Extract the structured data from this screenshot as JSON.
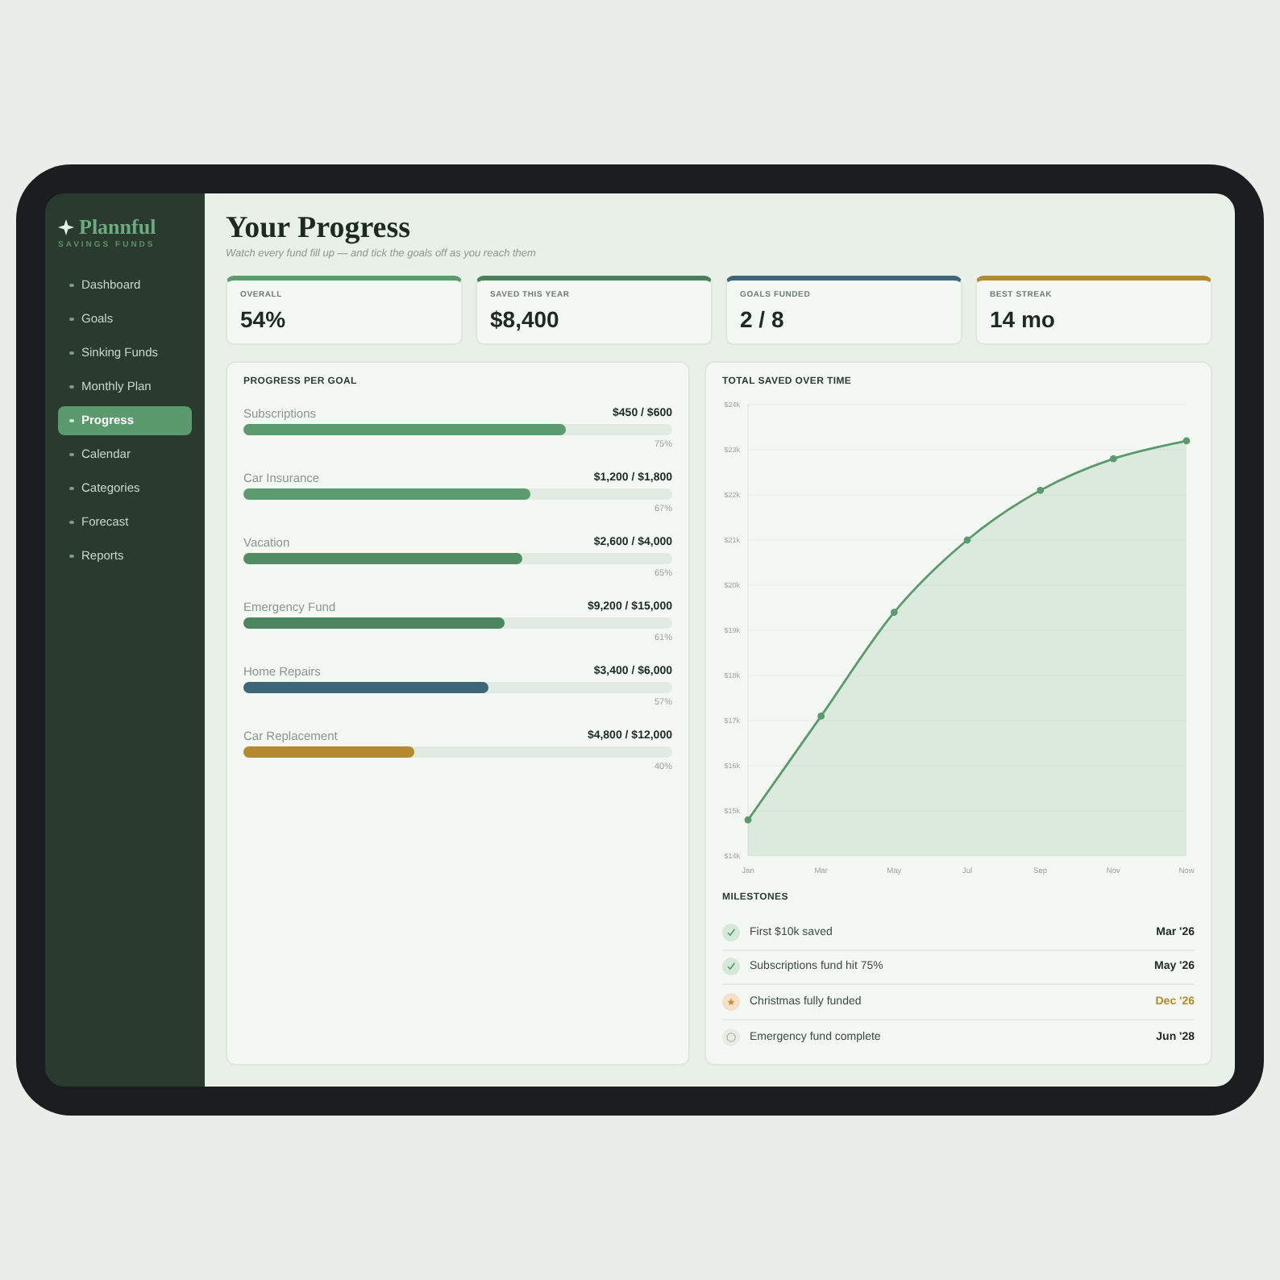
{
  "app": {
    "logo": "Plannful",
    "tagline": "SAVINGS FUNDS"
  },
  "sidebar": {
    "items": [
      {
        "label": "Dashboard",
        "selected": false
      },
      {
        "label": "Goals",
        "selected": false
      },
      {
        "label": "Sinking Funds",
        "selected": false
      },
      {
        "label": "Monthly Plan",
        "selected": false
      },
      {
        "label": "Progress",
        "selected": true
      },
      {
        "label": "Calendar",
        "selected": false
      },
      {
        "label": "Categories",
        "selected": false
      },
      {
        "label": "Forecast",
        "selected": false
      },
      {
        "label": "Reports",
        "selected": false
      }
    ]
  },
  "header": {
    "title": "Your Progress",
    "subtitle": "Watch every fund fill up — and tick the goals off as you reach them"
  },
  "stats": [
    {
      "label": "OVERALL",
      "value": "54%",
      "color": "#5b9c6c"
    },
    {
      "label": "SAVED THIS YEAR",
      "value": "$8,400",
      "color": "#4a805b"
    },
    {
      "label": "GOALS FUNDED",
      "value": "2 / 8",
      "color": "#3e6579"
    },
    {
      "label": "BEST STREAK",
      "value": "14 mo",
      "color": "#b38a32"
    }
  ],
  "goals_panel": {
    "title": "PROGRESS PER GOAL",
    "goals": [
      {
        "name": "Subscriptions",
        "amount": "$450 / $600",
        "level": 0.75,
        "percent": "75%",
        "color": "#5b9b6e"
      },
      {
        "name": "Car Insurance",
        "amount": "$1,200 / $1,800",
        "level": 0.67,
        "percent": "67%",
        "color": "#5b9b6e"
      },
      {
        "name": "Vacation",
        "amount": "$2,600 / $4,000",
        "level": 0.65,
        "percent": "65%",
        "color": "#528e64"
      },
      {
        "name": "Emergency Fund",
        "amount": "$9,200 / $15,000",
        "level": 0.61,
        "percent": "61%",
        "color": "#4c8660"
      },
      {
        "name": "Home Repairs",
        "amount": "$3,400 / $6,000",
        "level": 0.57,
        "percent": "57%",
        "color": "#3e6679"
      },
      {
        "name": "Car Replacement",
        "amount": "$4,800 / $12,000",
        "level": 0.4,
        "percent": "40%",
        "color": "#b38a32"
      }
    ]
  },
  "chart_panel": {
    "title": "TOTAL SAVED OVER TIME",
    "chart_data": {
      "type": "area",
      "grid": true,
      "categories": [
        "Jan",
        "Mar",
        "May",
        "Jul",
        "Sep",
        "Nov",
        "Now"
      ],
      "series": [
        {
          "color": "#5a9a6c",
          "values": [
            14800,
            17100,
            19400,
            21000,
            22100,
            22800,
            23200
          ]
        }
      ],
      "ylim": [
        14000,
        24000
      ],
      "yticks": [
        {
          "value": 14000,
          "label": "$14k"
        },
        {
          "value": 15000,
          "label": "$15k"
        },
        {
          "value": 16000,
          "label": "$16k"
        },
        {
          "value": 17000,
          "label": "$17k"
        },
        {
          "value": 18000,
          "label": "$18k"
        },
        {
          "value": 19000,
          "label": "$19k"
        },
        {
          "value": 20000,
          "label": "$20k"
        },
        {
          "value": 21000,
          "label": "$21k"
        },
        {
          "value": 22000,
          "label": "$22k"
        },
        {
          "value": 23000,
          "label": "$23k"
        },
        {
          "value": 24000,
          "label": "$24k"
        }
      ]
    }
  },
  "milestones": {
    "title": "MILESTONES",
    "items": [
      {
        "label": "First $10k saved",
        "date": "Mar '26",
        "kind": "done"
      },
      {
        "label": "Subscriptions fund hit 75%",
        "date": "May '26",
        "kind": "done"
      },
      {
        "label": "Christmas fully funded",
        "date": "Dec '26",
        "kind": "upcoming"
      },
      {
        "label": "Emergency fund complete",
        "date": "Jun '28",
        "kind": "pending"
      }
    ]
  }
}
